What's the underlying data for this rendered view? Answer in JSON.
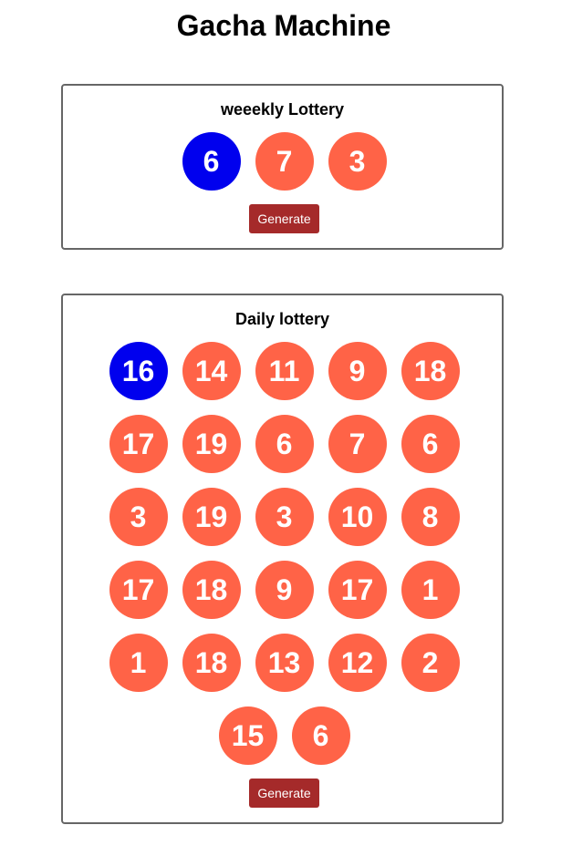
{
  "page": {
    "title": "Gacha Machine"
  },
  "colors": {
    "bonus_ball": "#0000ee",
    "ball": "#ff6347",
    "button": "#a52a2a",
    "border": "#666666"
  },
  "weekly": {
    "title": "weeekly Lottery",
    "balls": [
      "6",
      "7",
      "3"
    ],
    "button_label": "Generate"
  },
  "daily": {
    "title": "Daily lottery",
    "balls": [
      "16",
      "14",
      "11",
      "9",
      "18",
      "17",
      "19",
      "6",
      "7",
      "6",
      "3",
      "19",
      "3",
      "10",
      "8",
      "17",
      "18",
      "9",
      "17",
      "1",
      "1",
      "18",
      "13",
      "12",
      "2",
      "15",
      "6"
    ],
    "button_label": "Generate"
  }
}
